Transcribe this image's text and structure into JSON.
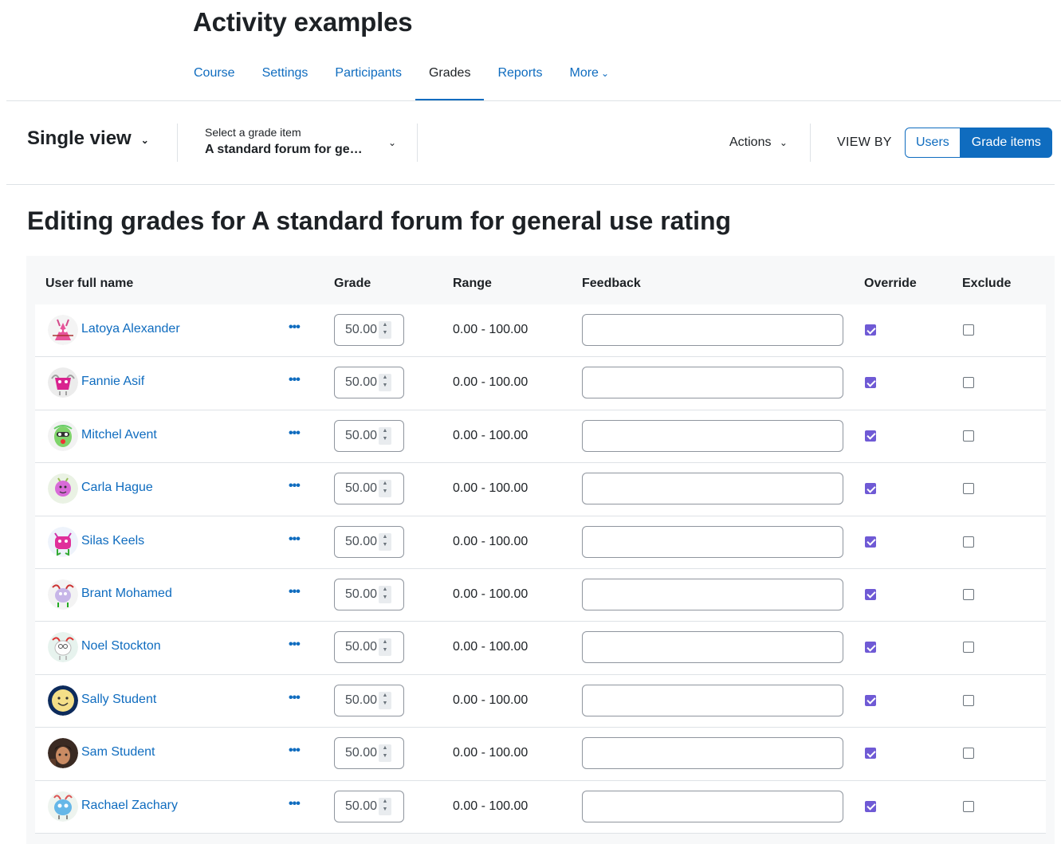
{
  "course": {
    "title": "Activity examples"
  },
  "nav": {
    "items": [
      {
        "label": "Course"
      },
      {
        "label": "Settings"
      },
      {
        "label": "Participants"
      },
      {
        "label": "Grades"
      },
      {
        "label": "Reports"
      },
      {
        "label": "More"
      }
    ],
    "active": "Grades"
  },
  "tertiary": {
    "view_label": "Single view",
    "grade_item_label": "Select a grade item",
    "grade_item_value": "A standard forum for general use rating",
    "actions_label": "Actions",
    "view_by_label": "VIEW BY",
    "view_by_users": "Users",
    "view_by_grade_items": "Grade items"
  },
  "page": {
    "heading": "Editing grades for A standard forum for general use rating"
  },
  "table": {
    "headers": {
      "name": "User full name",
      "grade": "Grade",
      "range": "Range",
      "feedback": "Feedback",
      "override": "Override",
      "exclude": "Exclude"
    },
    "rows": [
      {
        "name": "Latoya Alexander",
        "grade": "50.00",
        "range": "0.00 - 100.00",
        "feedback": "",
        "override": true,
        "exclude": false,
        "avatar_icon": "pink-monster-avatar-icon"
      },
      {
        "name": "Fannie Asif",
        "grade": "50.00",
        "range": "0.00 - 100.00",
        "feedback": "",
        "override": true,
        "exclude": false,
        "avatar_icon": "magenta-monster-avatar-icon"
      },
      {
        "name": "Mitchel Avent",
        "grade": "50.00",
        "range": "0.00 - 100.00",
        "feedback": "",
        "override": true,
        "exclude": false,
        "avatar_icon": "green-monster-avatar-icon"
      },
      {
        "name": "Carla Hague",
        "grade": "50.00",
        "range": "0.00 - 100.00",
        "feedback": "",
        "override": true,
        "exclude": false,
        "avatar_icon": "purple-monster-avatar-icon"
      },
      {
        "name": "Silas Keels",
        "grade": "50.00",
        "range": "0.00 - 100.00",
        "feedback": "",
        "override": true,
        "exclude": false,
        "avatar_icon": "pink-green-monster-avatar-icon"
      },
      {
        "name": "Brant Mohamed",
        "grade": "50.00",
        "range": "0.00 - 100.00",
        "feedback": "",
        "override": true,
        "exclude": false,
        "avatar_icon": "lavender-monster-avatar-icon"
      },
      {
        "name": "Noel Stockton",
        "grade": "50.00",
        "range": "0.00 - 100.00",
        "feedback": "",
        "override": true,
        "exclude": false,
        "avatar_icon": "white-monster-avatar-icon"
      },
      {
        "name": "Sally Student",
        "grade": "50.00",
        "range": "0.00 - 100.00",
        "feedback": "",
        "override": true,
        "exclude": false,
        "avatar_icon": "smiley-face-avatar-icon"
      },
      {
        "name": "Sam Student",
        "grade": "50.00",
        "range": "0.00 - 100.00",
        "feedback": "",
        "override": true,
        "exclude": false,
        "avatar_icon": "photo-avatar-icon"
      },
      {
        "name": "Rachael Zachary",
        "grade": "50.00",
        "range": "0.00 - 100.00",
        "feedback": "",
        "override": true,
        "exclude": false,
        "avatar_icon": "blue-monster-avatar-icon"
      }
    ]
  },
  "colors": {
    "link": "#0f6cbf",
    "checkbox": "#6f5ad5",
    "text": "#1d2125"
  }
}
